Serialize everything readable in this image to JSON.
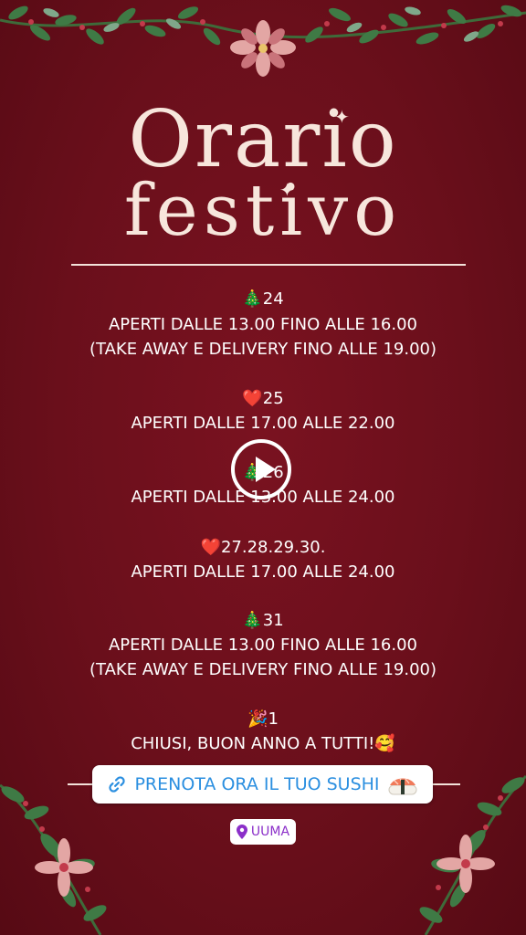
{
  "title": {
    "line1": "Orario",
    "line2": "festivo"
  },
  "schedule": [
    {
      "icon": "christmas-tree-icon",
      "date": "🎄24",
      "lines": [
        "APERTI DALLE 13.00 FINO ALLE 16.00",
        "(TAKE AWAY E DELIVERY FINO ALLE 19.00)"
      ]
    },
    {
      "icon": "heart-icon",
      "date": "❤️25",
      "lines": [
        "APERTI DALLE 17.00 ALLE 22.00"
      ]
    },
    {
      "icon": "christmas-tree-icon",
      "date": "🎄26",
      "lines": [
        "APERTI DALLE 13.00 ALLE 24.00"
      ]
    },
    {
      "icon": "heart-icon",
      "date": "❤️27.28.29.30.",
      "lines": [
        "APERTI DALLE 17.00 ALLE 24.00"
      ]
    },
    {
      "icon": "christmas-tree-icon",
      "date": "🎄31",
      "lines": [
        "APERTI DALLE 13.00 FINO ALLE 16.00",
        "(TAKE AWAY E DELIVERY FINO ALLE 19.00)"
      ]
    },
    {
      "icon": "party-popper-icon",
      "date": "🎉1",
      "lines": [
        "CHIUSI, BUON ANNO A TUTTI!🥰"
      ]
    }
  ],
  "link_sticker": {
    "label": "PRENOTA ORA IL TUO SUSHI",
    "icon": "link-icon",
    "trailing_icon": "sushi-icon",
    "color": "#2b8fe0"
  },
  "location_sticker": {
    "label": "UUMA",
    "icon": "location-pin-icon",
    "color": "#8b2fc9"
  },
  "colors": {
    "background": "#6a0f1b",
    "text": "#ffffff",
    "title": "#f7e6dc"
  }
}
